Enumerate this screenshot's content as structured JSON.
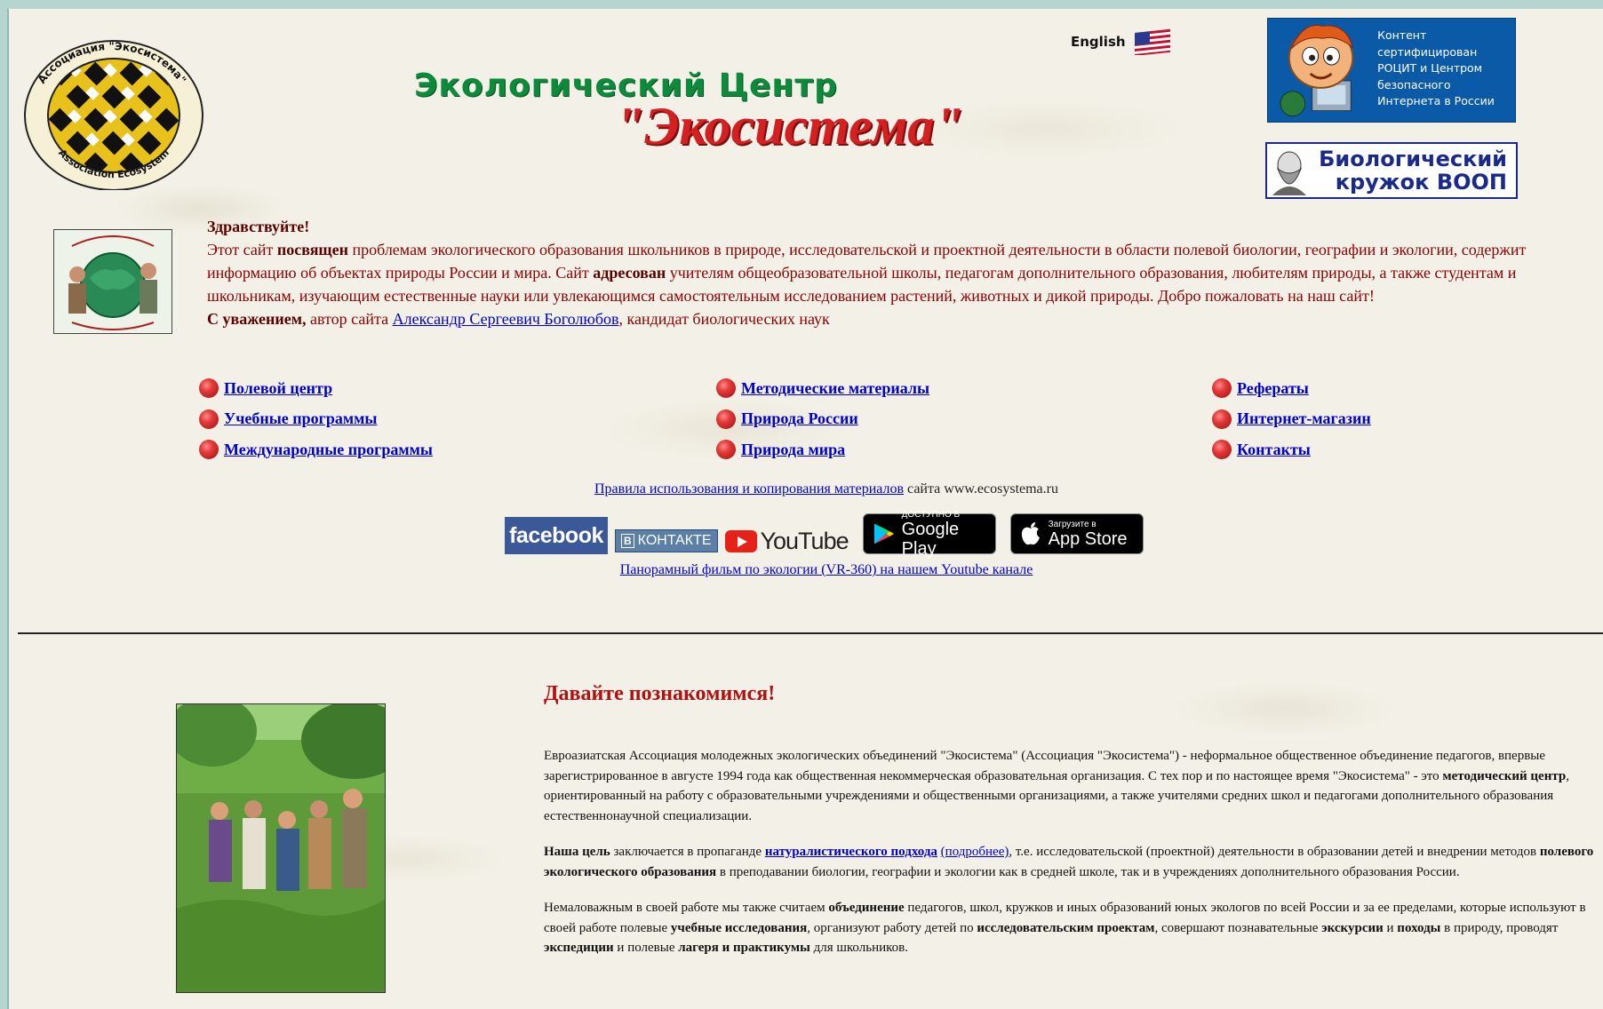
{
  "header": {
    "association_logo": {
      "top_text": "Ассоциация \"Экосистема\"",
      "bottom_text": "Association Ecosystem"
    },
    "title_line1": "Экологический Центр",
    "title_line2": "\"Экосистема\"",
    "language_link": "English",
    "rocit_badge": [
      "Контент",
      "сертифицирован",
      "РОЦИТ и Центром",
      "безопасного",
      "Интернета в России"
    ],
    "bio_circle": {
      "line1": "Биологический",
      "line2": "кружок ВООП"
    }
  },
  "greeting": {
    "hello": "Здравствуйте!",
    "p1_a": "Этот сайт ",
    "p1_b": "посвящен",
    "p1_c": " проблемам экологического образования школьников в природе, исследовательской и проектной деятельности в области полевой биологии, географии и экологии, содержит информацию об объектах природы России и мира. Сайт ",
    "p1_d": "адресован",
    "p1_e": " учителям общеобразовательной школы, педагогам дополнительного образования, любителям природы, а также студентам и школьникам, изучающим естественные науки или увлекающимся самостоятельным исследованием растений, животных и дикой природы. Добро пожаловать на наш сайт!",
    "sign_bold": "С уважением,",
    "sign_text": " автор сайта ",
    "author_link": "Александр Сергеевич Боголюбов",
    "sign_tail": ", кандидат биологических наук"
  },
  "nav": {
    "col1": [
      "Полевой центр",
      "Учебные программы",
      "Международные программы"
    ],
    "col2": [
      "Методические материалы",
      "Природа России",
      "Природа мира"
    ],
    "col3": [
      "Рефераты",
      "Интернет-магазин",
      "Контакты"
    ]
  },
  "rules": {
    "link": "Правила использования и копирования материалов",
    "tail": " сайта www.ecosystema.ru"
  },
  "social": {
    "facebook": "facebook",
    "vk": "КОНТАКТЕ",
    "vk_b": "В",
    "youtube": "YouTube",
    "google_small": "ДОСТУПНО В",
    "google_big": "Google Play",
    "apple_small": "Загрузите в",
    "apple_big": "App Store"
  },
  "vr_link": "Панорамный фильм по экологии (VR-360) на нашем Youtube канале",
  "about": {
    "title": "Давайте познакомимся!",
    "p1_a": "Евроазиатская Ассоциация молодежных экологических объединений \"Экосистема\" (Ассоциация \"Экосистема\") - неформальное общественное объединение педагогов, впервые зарегистрированное в августе 1994 года как общественная некоммерческая образовательная организация. С тех пор и по настоящее время \"Экосистема\" - это ",
    "p1_b": "методический центр",
    "p1_c": ", ориентированный на работу с образовательными учреждениями и общественными организациями, а также учителями средних школ и педагогами дополнительного образования естественнонаучной специализации.",
    "p2_a": "Наша цель",
    "p2_b": " заключается в пропаганде ",
    "p2_link": "натуралистического подхода",
    "p2_link2": "(подробнее)",
    "p2_c": ", т.е. исследовательской (проектной) деятельности в образовании детей и внедрении методов ",
    "p2_d": "полевого экологического образования",
    "p2_e": " в преподавании биологии, географии и экологии как в средней школе, так и в учреждениях дополнительного образования России.",
    "p3_a": "Немаловажным в своей работе мы также считаем ",
    "p3_b": "объединение",
    "p3_c": " педагогов, школ, кружков и иных образований юных экологов по всей России и за ее пределами, которые используют в своей работе полевые ",
    "p3_d": "учебные исследования",
    "p3_e": ", организуют работу детей по ",
    "p3_f": "исследовательским проектам",
    "p3_g": ", совершают познавательные ",
    "p3_h": "экскурсии",
    "p3_i": " и ",
    "p3_j": "походы",
    "p3_k": " в природу, проводят ",
    "p3_l": "экспедиции",
    "p3_m": " и полевые ",
    "p3_n": "лагеря и практикумы",
    "p3_o": " для школьников."
  }
}
